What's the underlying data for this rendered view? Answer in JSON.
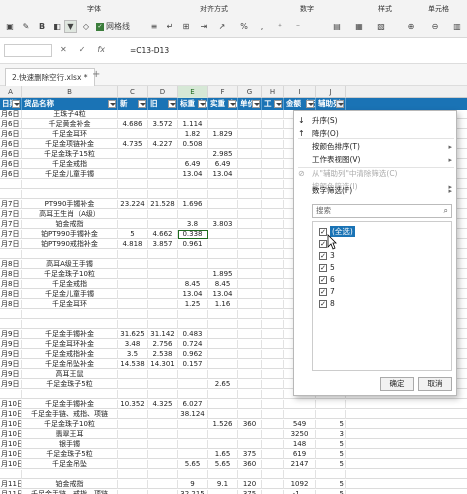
{
  "ribbon": {
    "groups": [
      "字体",
      "对齐方式",
      "数字",
      "样式",
      "单元格"
    ],
    "gridlines_label": "网格线"
  },
  "formula_bar": {
    "formula": "=C13-D13",
    "icons": [
      "cancel-icon",
      "confirm-icon",
      "fx-icon"
    ]
  },
  "sheet_tab": {
    "name": "2.快速删除空行.xlsx *"
  },
  "columns": [
    "A",
    "B",
    "C",
    "D",
    "E",
    "F",
    "G",
    "H",
    "I",
    "J"
  ],
  "headers": [
    "日期",
    "货品名称",
    "新",
    "旧",
    "标重（g",
    "实重（g",
    "单价",
    "工",
    "金额（元）",
    "辅助列"
  ],
  "rows": [
    [
      "月6日",
      "王珠子4粒",
      "",
      "",
      "",
      "",
      "",
      "",
      "",
      ""
    ],
    [
      "月6日",
      "千足黄金补金",
      "4.686",
      "3.572",
      "1.114",
      "",
      "",
      "",
      "",
      ""
    ],
    [
      "月6日",
      "千足金耳环",
      "",
      "",
      "1.82",
      "1.829",
      "",
      "",
      "",
      ""
    ],
    [
      "月6日",
      "千足金项链补金",
      "4.735",
      "4.227",
      "0.508",
      "",
      "",
      "",
      "",
      ""
    ],
    [
      "月6日",
      "千足金珠子15粒",
      "",
      "",
      "",
      "2.985",
      "",
      "",
      "",
      ""
    ],
    [
      "月6日",
      "千足金戒指",
      "",
      "",
      "6.49",
      "6.49",
      "",
      "",
      "",
      ""
    ],
    [
      "月6日",
      "千足金儿童手镯",
      "",
      "",
      "13.04",
      "13.04",
      "",
      "",
      "",
      ""
    ],
    [
      "",
      "",
      "",
      "",
      "",
      "",
      "",
      "",
      "",
      ""
    ],
    [
      "",
      "",
      "",
      "",
      "",
      "",
      "",
      "",
      "",
      ""
    ],
    [
      "月7日",
      "PT990手镯补金",
      "23.224",
      "21.528",
      "1.696",
      "",
      "",
      "",
      "",
      ""
    ],
    [
      "月7日",
      "高耳王生肖（A级）",
      "",
      "",
      "",
      "",
      "",
      "",
      "",
      ""
    ],
    [
      "月7日",
      "铂金戒指",
      "",
      "",
      "3.8",
      "3.803",
      "",
      "",
      "",
      ""
    ],
    [
      "月7日",
      "铂PT990手镯补金",
      "5",
      "4.662",
      "0.338",
      "",
      "",
      "",
      "",
      ""
    ],
    [
      "月7日",
      "铂PT990戒指补金",
      "4.818",
      "3.857",
      "0.961",
      "",
      "",
      "",
      "",
      ""
    ],
    [
      "",
      "",
      "",
      "",
      "",
      "",
      "",
      "",
      "",
      ""
    ],
    [
      "月8日",
      "高耳A级王手镯",
      "",
      "",
      "",
      "",
      "",
      "",
      "",
      ""
    ],
    [
      "月8日",
      "千足金珠子10粒",
      "",
      "",
      "",
      "1.895",
      "",
      "",
      "",
      ""
    ],
    [
      "月8日",
      "千足金戒指",
      "",
      "",
      "8.45",
      "8.45",
      "",
      "",
      "",
      ""
    ],
    [
      "月8日",
      "千足金儿童手镯",
      "",
      "",
      "13.04",
      "13.04",
      "",
      "",
      "",
      ""
    ],
    [
      "月8日",
      "千足金耳环",
      "",
      "",
      "1.25",
      "1.16",
      "",
      "",
      "",
      ""
    ],
    [
      "",
      "",
      "",
      "",
      "",
      "",
      "",
      "",
      "",
      ""
    ],
    [
      "",
      "",
      "",
      "",
      "",
      "",
      "",
      "",
      "",
      ""
    ],
    [
      "月9日",
      "千足金手镯补金",
      "31.625",
      "31.142",
      "0.483",
      "",
      "",
      "",
      "",
      ""
    ],
    [
      "月9日",
      "千足金耳环补金",
      "3.48",
      "2.756",
      "0.724",
      "",
      "",
      "",
      "",
      ""
    ],
    [
      "月9日",
      "千足金戒指补金",
      "3.5",
      "2.538",
      "0.962",
      "",
      "",
      "",
      "",
      ""
    ],
    [
      "月9日",
      "千足金吊坠补金",
      "14.538",
      "14.301",
      "0.157",
      "",
      "",
      "",
      "",
      ""
    ],
    [
      "月9日",
      "高耳王鼠",
      "",
      "",
      "",
      "",
      "",
      "",
      "",
      ""
    ],
    [
      "月9日",
      "千足金珠子5粒",
      "",
      "",
      "",
      "2.65",
      "",
      "",
      "",
      ""
    ],
    [
      "",
      "",
      "",
      "",
      "",
      "",
      "",
      "",
      "",
      ""
    ],
    [
      "月10日",
      "千足金手镯补金",
      "10.352",
      "4.325",
      "6.027",
      "",
      "",
      "",
      "",
      ""
    ],
    [
      "月10日",
      "千足金手链、戒指、项链",
      "",
      "",
      "38.124",
      "",
      "",
      "",
      "",
      ""
    ],
    [
      "月10日",
      "千足金珠子10粒",
      "",
      "",
      "",
      "1.526",
      "360",
      "",
      "549",
      "5"
    ],
    [
      "月10日",
      "翡翠王耳",
      "",
      "",
      "",
      "",
      "",
      "",
      "3250",
      "3"
    ],
    [
      "月10日",
      "银手镯",
      "",
      "",
      "",
      "",
      "",
      "",
      "148",
      "5"
    ],
    [
      "月10日",
      "千足金珠子5粒",
      "",
      "",
      "",
      "1.65",
      "375",
      "",
      "619",
      "5"
    ],
    [
      "月10日",
      "千足金吊坠",
      "",
      "",
      "5.65",
      "5.65",
      "360",
      "",
      "2147",
      "5"
    ],
    [
      "",
      "",
      "",
      "",
      "",
      "",
      "",
      "",
      "",
      ""
    ],
    [
      "月11日",
      "铂金戒指",
      "",
      "",
      "9",
      "9.1",
      "120",
      "",
      "1092",
      "5"
    ],
    [
      "月11日",
      "千足金手链、戒指、项链",
      "",
      "",
      "32.215",
      "",
      "375",
      "",
      "-1...",
      "5"
    ],
    [
      "月11日",
      "千足金珠子2粒",
      "",
      "",
      "",
      "2.258",
      "375",
      "",
      "847",
      "5"
    ]
  ],
  "filter_menu": {
    "items": [
      {
        "icon": "sort-asc-icon",
        "label": "升序(S)",
        "disabled": false,
        "submenu": false
      },
      {
        "icon": "sort-desc-icon",
        "label": "降序(O)",
        "disabled": false,
        "submenu": false
      },
      {
        "icon": "",
        "label": "按颜色排序(T)",
        "disabled": false,
        "submenu": true
      },
      {
        "icon": "",
        "label": "工作表视图(V)",
        "disabled": false,
        "submenu": true
      },
      {
        "icon": "clear-filter-icon",
        "label": "从\"辅助列\"中清除筛选(C)",
        "disabled": true,
        "submenu": false
      },
      {
        "icon": "",
        "label": "按颜色筛选(I)",
        "disabled": true,
        "submenu": true
      },
      {
        "icon": "",
        "label": "数字筛选(F)",
        "disabled": false,
        "submenu": true
      }
    ],
    "search_placeholder": "搜索",
    "list": [
      {
        "label": "(全选)",
        "checked": true,
        "selected": true
      },
      {
        "label": "",
        "checked": true,
        "selected": false
      },
      {
        "label": "3",
        "checked": true,
        "selected": false
      },
      {
        "label": "5",
        "checked": true,
        "selected": false
      },
      {
        "label": "6",
        "checked": true,
        "selected": false
      },
      {
        "label": "7",
        "checked": true,
        "selected": false
      },
      {
        "label": "8",
        "checked": true,
        "selected": false
      }
    ],
    "ok_label": "确定",
    "cancel_label": "取消"
  }
}
